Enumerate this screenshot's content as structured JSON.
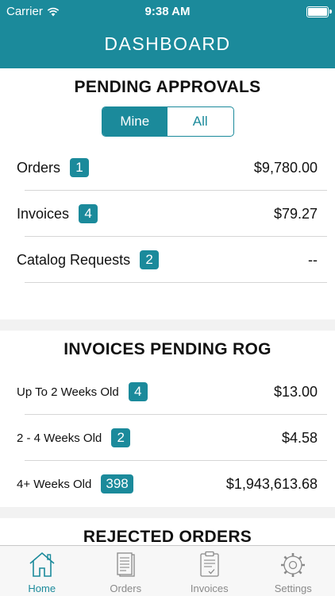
{
  "status_bar": {
    "carrier": "Carrier",
    "time": "9:38 AM"
  },
  "nav": {
    "title": "DASHBOARD"
  },
  "pending_approvals": {
    "title": "PENDING APPROVALS",
    "segments": [
      "Mine",
      "All"
    ],
    "selected_segment": "Mine",
    "rows": [
      {
        "label": "Orders",
        "badge": "1",
        "amount": "$9,780.00"
      },
      {
        "label": "Invoices",
        "badge": "4",
        "amount": "$79.27"
      },
      {
        "label": "Catalog Requests",
        "badge": "2",
        "amount": "--"
      }
    ]
  },
  "invoices_pending_rog": {
    "title": "INVOICES PENDING ROG",
    "rows": [
      {
        "label": "Up To 2 Weeks Old",
        "badge": "4",
        "amount": "$13.00"
      },
      {
        "label": "2 - 4 Weeks Old",
        "badge": "2",
        "amount": "$4.58"
      },
      {
        "label": "4+ Weeks Old",
        "badge": "398",
        "amount": "$1,943,613.68"
      }
    ]
  },
  "rejected_orders": {
    "title": "REJECTED ORDERS"
  },
  "tabbar": {
    "active": "Home",
    "tabs": [
      {
        "label": "Home",
        "icon": "home-icon"
      },
      {
        "label": "Orders",
        "icon": "orders-icon"
      },
      {
        "label": "Invoices",
        "icon": "invoices-icon"
      },
      {
        "label": "Settings",
        "icon": "settings-icon"
      }
    ]
  },
  "colors": {
    "accent": "#1b8a9b",
    "inactive_tab": "#8a8a8a"
  }
}
